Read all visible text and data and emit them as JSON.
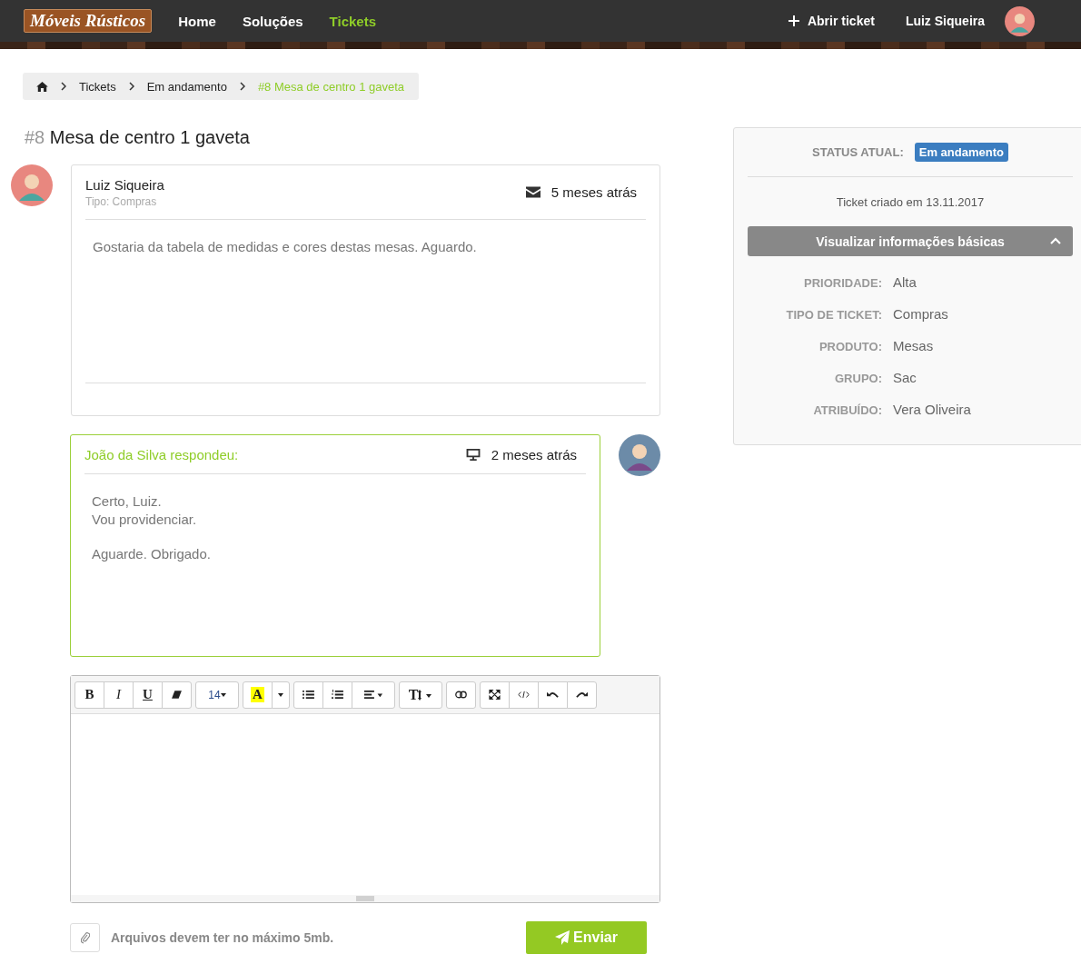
{
  "header": {
    "logo": "Móveis Rústicos",
    "nav": [
      {
        "label": "Home",
        "selected": false
      },
      {
        "label": "Soluções",
        "selected": false
      },
      {
        "label": "Tickets",
        "selected": true
      }
    ],
    "open_ticket": "Abrir ticket",
    "user_name": "Luiz Siqueira"
  },
  "breadcrumb": [
    {
      "label": "Tickets",
      "selected": false
    },
    {
      "label": "Em andamento",
      "selected": false
    },
    {
      "label": "#8 Mesa de centro 1 gaveta",
      "selected": true
    }
  ],
  "ticket": {
    "number": "#8",
    "title": "Mesa de centro 1 gaveta"
  },
  "messages": [
    {
      "kind": "customer",
      "author": "Luiz Siqueira",
      "subtitle": "Tipo: Compras",
      "time": "5 meses atrás",
      "paragraphs": [
        "Gostaria da tabela de medidas e cores destas mesas. Aguardo."
      ]
    },
    {
      "kind": "agent",
      "author": "João da Silva respondeu:",
      "time": "2 meses atrás",
      "paragraphs": [
        "Certo, Luiz.\nVou providenciar.",
        "Aguarde. Obrigado."
      ]
    }
  ],
  "editor": {
    "bold": "B",
    "italic": "I",
    "underline": "U",
    "font_size": "14",
    "highlight": "A",
    "text_size": "T"
  },
  "attachment_note": "Arquivos devem ter no máximo 5mb.",
  "send_button": "Enviar",
  "sidebar": {
    "status_label": "STATUS ATUAL:",
    "status": "Em andamento",
    "created": "Ticket criado em 13.11.2017",
    "details_toggle": "Visualizar informações básicas",
    "expanded": true,
    "details": [
      {
        "label": "PRIORIDADE:",
        "value": "Alta"
      },
      {
        "label": "TIPO DE TICKET:",
        "value": "Compras"
      },
      {
        "label": "PRODUTO:",
        "value": "Mesas"
      },
      {
        "label": "GRUPO:",
        "value": "Sac"
      },
      {
        "label": "ATRIBUÍDO:",
        "value": "Vera Oliveira"
      }
    ]
  }
}
